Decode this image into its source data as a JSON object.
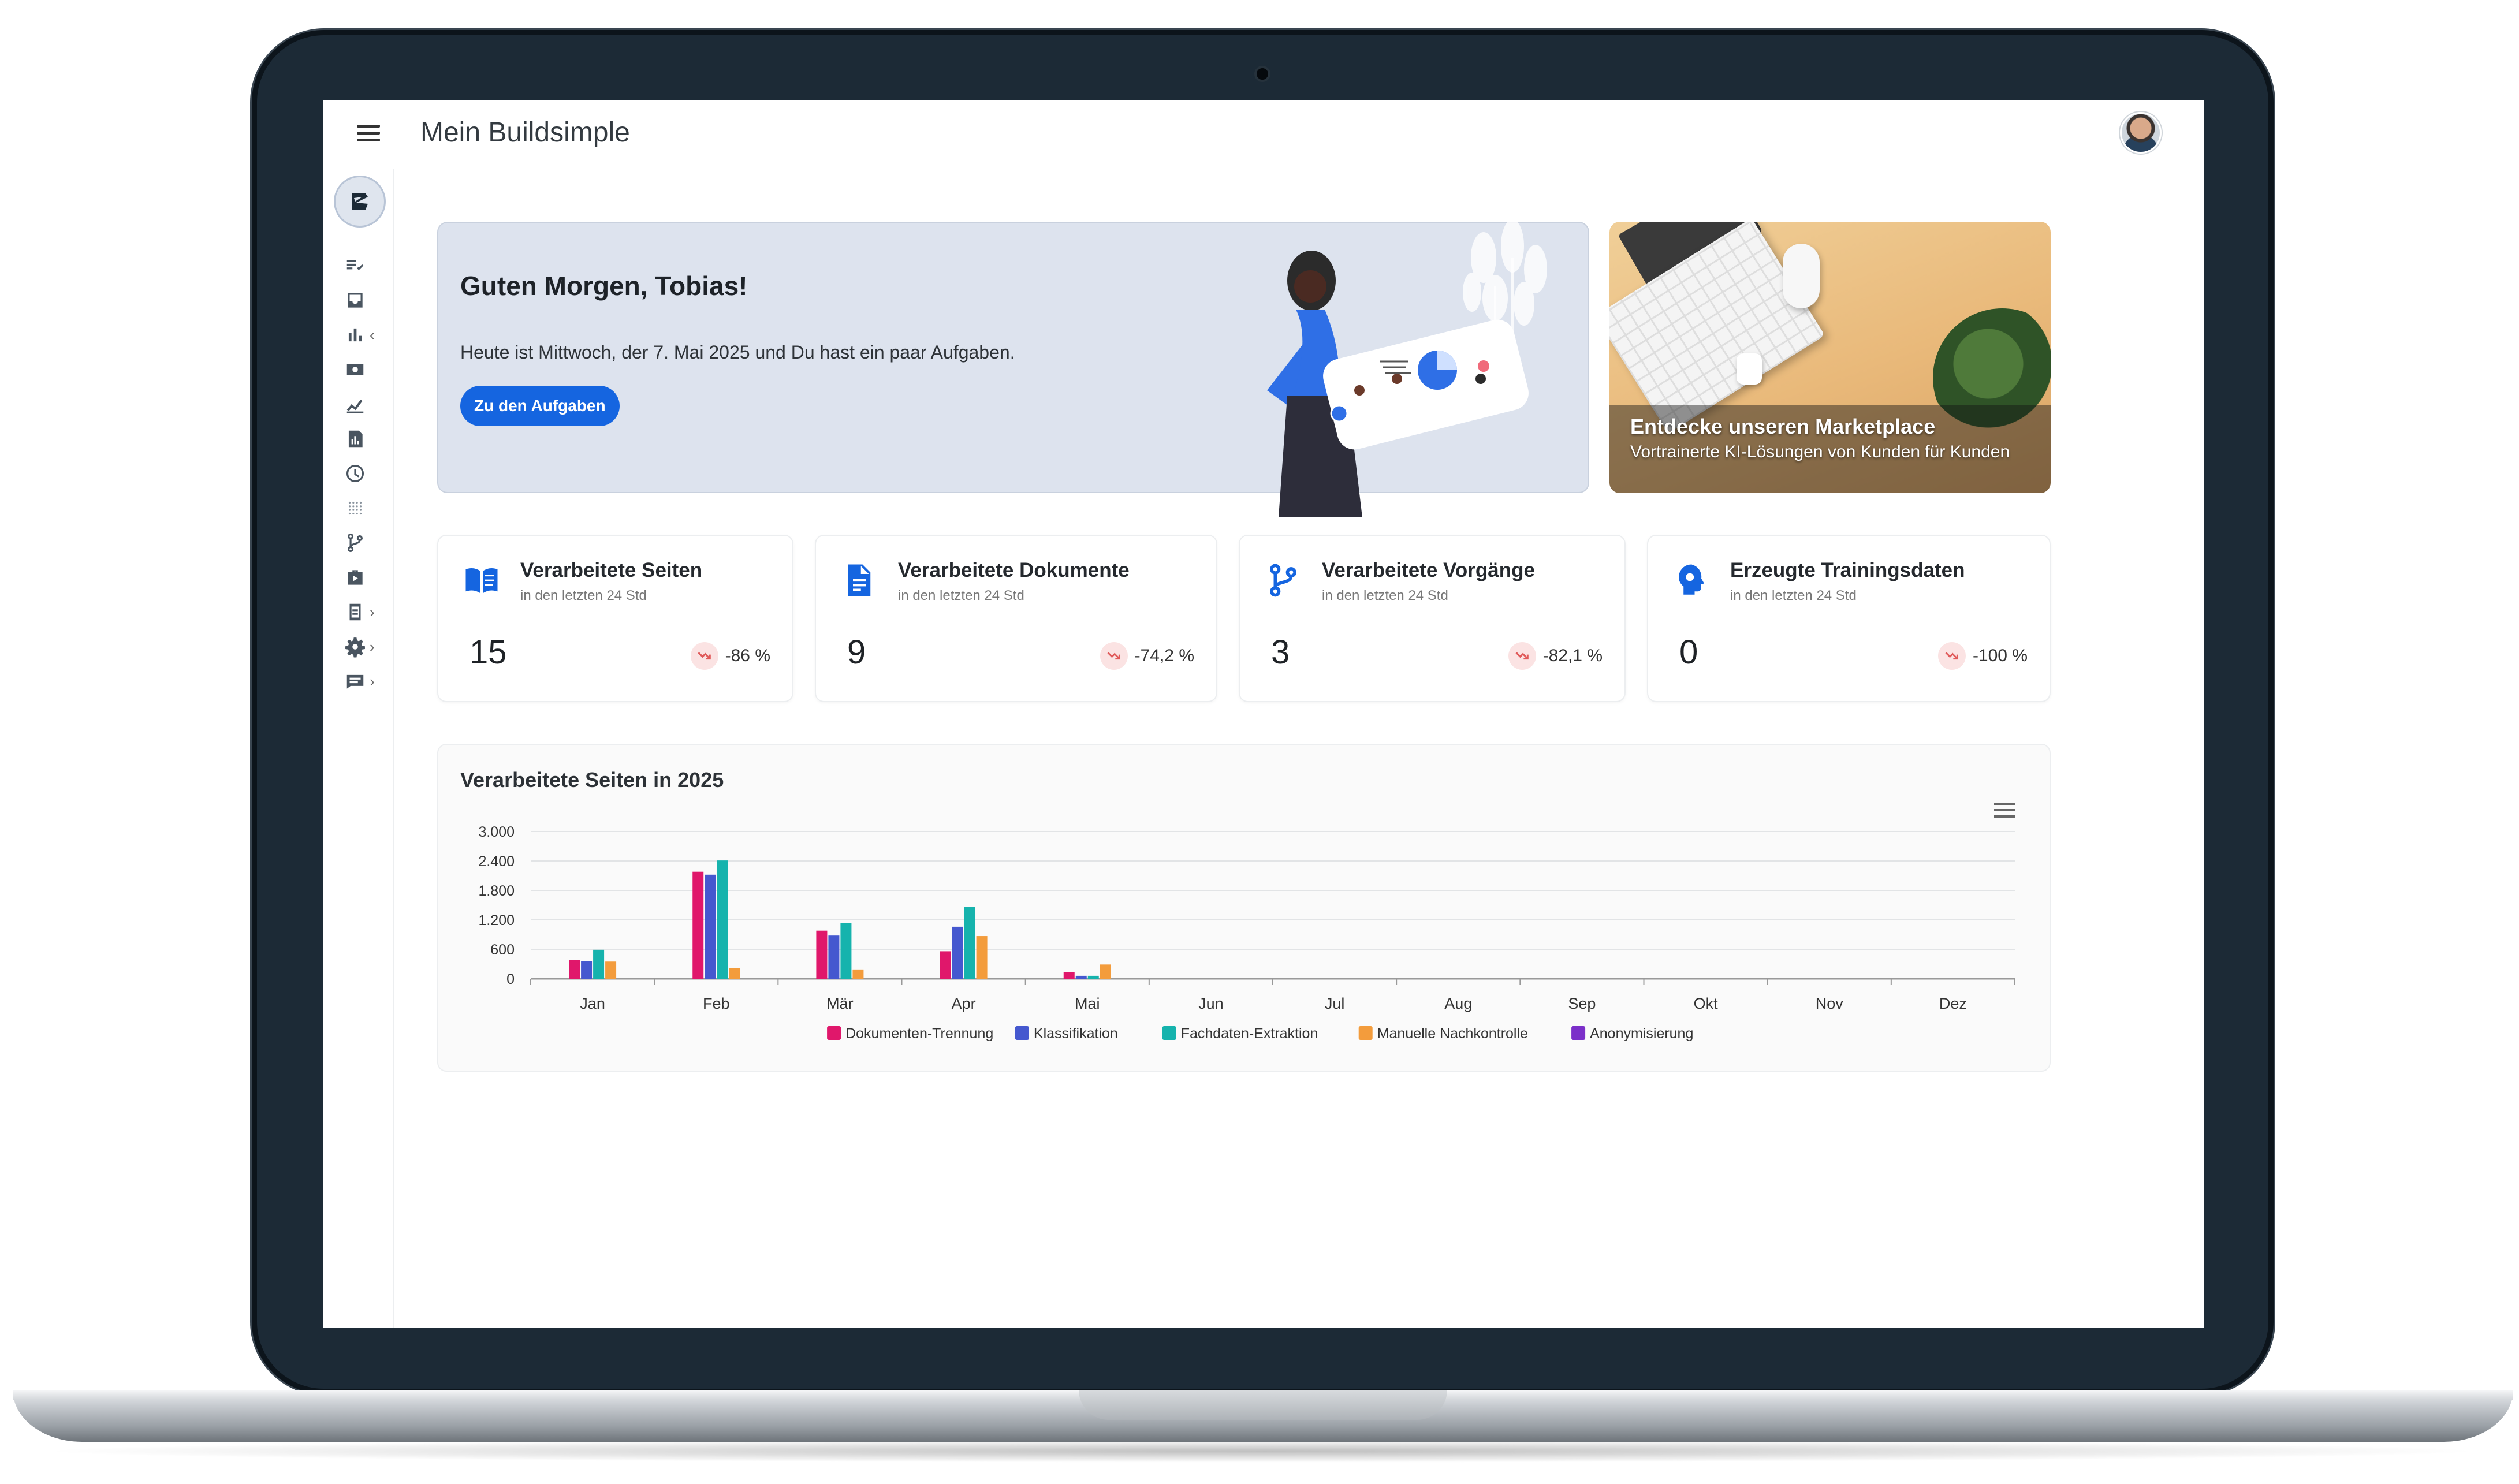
{
  "app": {
    "title": "Mein Buildsimple"
  },
  "sidebar": {
    "items": [
      {
        "id": "tasks",
        "icon": "checklist-icon"
      },
      {
        "id": "inbox",
        "icon": "inbox-icon"
      },
      {
        "id": "analytics",
        "icon": "bar-chart-icon",
        "arrow": "‹"
      },
      {
        "id": "billing",
        "icon": "money-icon"
      },
      {
        "id": "trends",
        "icon": "trend-icon"
      },
      {
        "id": "reports",
        "icon": "report-icon"
      },
      {
        "id": "history",
        "icon": "clock-icon"
      },
      {
        "id": "grid",
        "icon": "grid-icon"
      },
      {
        "id": "workflows",
        "icon": "branch-icon"
      },
      {
        "id": "marketplace",
        "icon": "briefcase-icon"
      },
      {
        "id": "integrations",
        "icon": "device-icon",
        "arrow": "›"
      },
      {
        "id": "settings",
        "icon": "gear-icon",
        "arrow": "›"
      },
      {
        "id": "messages",
        "icon": "message-icon",
        "arrow": "›"
      }
    ]
  },
  "hero": {
    "greeting": "Guten Morgen, Tobias!",
    "text": "Heute ist Mittwoch, der 7. Mai 2025 und Du hast ein paar Aufgaben.",
    "button": "Zu den Aufgaben"
  },
  "marketplace": {
    "title": "Entdecke unseren Marketplace",
    "subtitle": "Vortrainerte KI-Lösungen von Kunden für Kunden"
  },
  "stats": [
    {
      "title": "Verarbeitete Seiten",
      "subtitle": "in den letzten 24 Std",
      "value": "15",
      "trend": "-86 %",
      "icon": "book-icon"
    },
    {
      "title": "Verarbeitete Dokumente",
      "subtitle": "in den letzten 24 Std",
      "value": "9",
      "trend": "-74,2 %",
      "icon": "document-icon"
    },
    {
      "title": "Verarbeitete Vorgänge",
      "subtitle": "in den letzten 24 Std",
      "value": "3",
      "trend": "-82,1 %",
      "icon": "branch-icon"
    },
    {
      "title": "Erzeugte Trainingsdaten",
      "subtitle": "in den letzten 24 Std",
      "value": "0",
      "trend": "-100 %",
      "icon": "brain-icon"
    }
  ],
  "colors": {
    "accent": "#1565e0",
    "trend_down": "#e05a5a"
  },
  "chart_data": {
    "type": "bar",
    "title": "Verarbeitete Seiten in 2025",
    "categories": [
      "Jan",
      "Feb",
      "Mär",
      "Apr",
      "Mai",
      "Jun",
      "Jul",
      "Aug",
      "Sep",
      "Okt",
      "Nov",
      "Dez"
    ],
    "yticks": [
      "0",
      "600",
      "1.200",
      "1.800",
      "2.400",
      "3.000"
    ],
    "ylim": [
      0,
      3000
    ],
    "grid": true,
    "legend_position": "bottom",
    "series": [
      {
        "name": "Dokumenten-Trennung",
        "color": "#e0176b",
        "values": [
          380,
          2180,
          980,
          560,
          130,
          0,
          0,
          0,
          0,
          0,
          0,
          0
        ]
      },
      {
        "name": "Klassifikation",
        "color": "#4558cf",
        "values": [
          360,
          2120,
          880,
          1060,
          60,
          0,
          0,
          0,
          0,
          0,
          0,
          0
        ]
      },
      {
        "name": "Fachdaten-Extraktion",
        "color": "#16b3ad",
        "values": [
          590,
          2410,
          1130,
          1470,
          60,
          0,
          0,
          0,
          0,
          0,
          0,
          0
        ]
      },
      {
        "name": "Manuelle Nachkontrolle",
        "color": "#f39c3c",
        "values": [
          350,
          220,
          190,
          870,
          290,
          0,
          0,
          0,
          0,
          0,
          0,
          0
        ]
      },
      {
        "name": "Anonymisierung",
        "color": "#7b2fc9",
        "values": [
          0,
          0,
          0,
          0,
          0,
          0,
          0,
          0,
          0,
          0,
          0,
          0
        ]
      }
    ]
  }
}
